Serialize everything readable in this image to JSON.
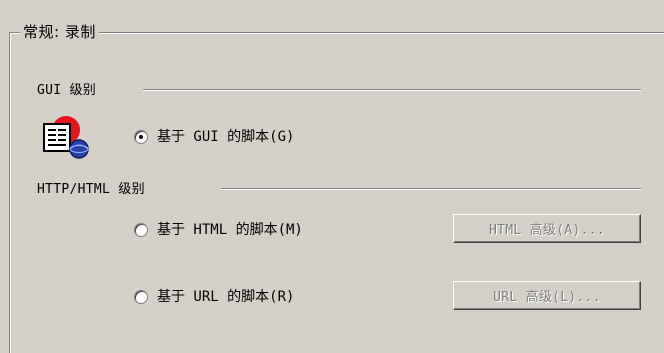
{
  "group": {
    "title": "常规: 录制"
  },
  "gui_section": {
    "label": "GUI 级别",
    "radio_label": "基于 GUI 的脚本(G)",
    "selected": true,
    "icon": "gui-script-icon"
  },
  "http_section": {
    "label": "HTTP/HTML 级别",
    "html_radio_label": "基于 HTML 的脚本(M)",
    "html_selected": false,
    "url_radio_label": "基于 URL 的脚本(R)",
    "url_selected": false,
    "html_advanced_button": "HTML 高级(A)...",
    "url_advanced_button": "URL 高级(L)..."
  }
}
